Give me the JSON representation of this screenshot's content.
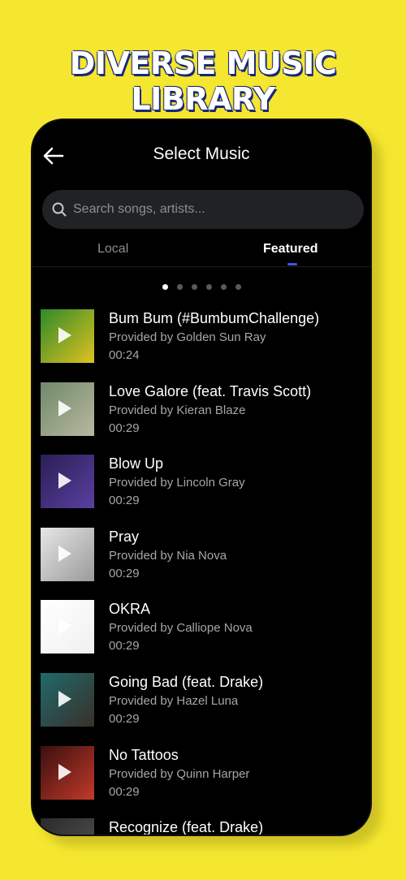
{
  "banner": {
    "text": "DIVERSE MUSIC LIBRARY"
  },
  "header": {
    "title": "Select Music",
    "back_icon": "arrow-left-icon"
  },
  "search": {
    "placeholder": "Search songs, artists...",
    "icon": "search-icon"
  },
  "tabs": [
    {
      "label": "Local",
      "active": false
    },
    {
      "label": "Featured",
      "active": true
    }
  ],
  "pagination": {
    "count": 6,
    "active_index": 0
  },
  "songs": [
    {
      "title": "Bum Bum (#BumbumChallenge)",
      "provider": "Provided by Golden Sun Ray",
      "duration": "00:24",
      "cover_colors": [
        "#2e8a2a",
        "#e0c21f"
      ]
    },
    {
      "title": "Love Galore (feat. Travis Scott)",
      "provider": "Provided by Kieran Blaze",
      "duration": "00:29",
      "cover_colors": [
        "#6f8a6a",
        "#b8b8a0"
      ]
    },
    {
      "title": "Blow Up",
      "provider": "Provided by Lincoln Gray",
      "duration": "00:29",
      "cover_colors": [
        "#2a1f55",
        "#5a3fa0"
      ]
    },
    {
      "title": "Pray",
      "provider": "Provided by Nia Nova",
      "duration": "00:29",
      "cover_colors": [
        "#e6e6e6",
        "#9a9a9a"
      ]
    },
    {
      "title": "OKRA",
      "provider": "Provided by Calliope Nova",
      "duration": "00:29",
      "cover_colors": [
        "#ffffff",
        "#f0f0f0"
      ]
    },
    {
      "title": "Going Bad (feat. Drake)",
      "provider": "Provided by Hazel Luna",
      "duration": "00:29",
      "cover_colors": [
        "#1f6a6a",
        "#3a2f2a"
      ]
    },
    {
      "title": "No Tattoos",
      "provider": "Provided by Quinn Harper",
      "duration": "00:29",
      "cover_colors": [
        "#3a0f0f",
        "#c23a2a"
      ]
    },
    {
      "title": "Recognize (feat. Drake)",
      "provider": "",
      "duration": "",
      "cover_colors": [
        "#2a2a2a",
        "#555555"
      ]
    }
  ]
}
